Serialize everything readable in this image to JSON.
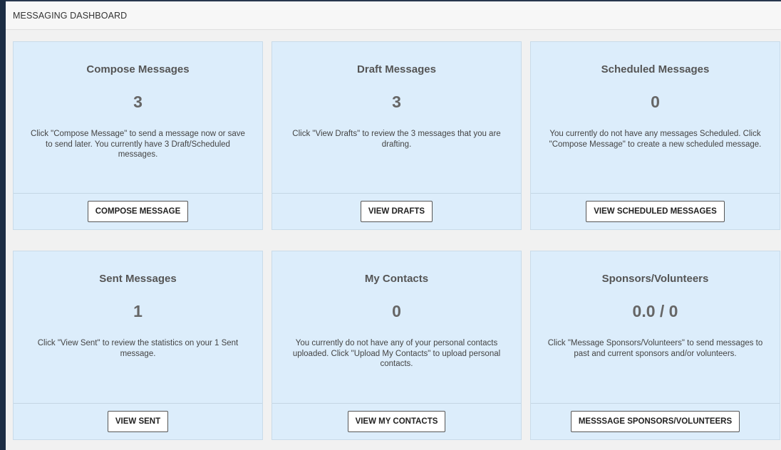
{
  "header": {
    "title": "MESSAGING DASHBOARD"
  },
  "cards": [
    {
      "title": "Compose Messages",
      "count": "3",
      "description": "Click \"Compose Message\" to send a message now or save to send later. You currently have 3 Draft/Scheduled messages.",
      "button": "COMPOSE MESSAGE"
    },
    {
      "title": "Draft Messages",
      "count": "3",
      "description": "Click \"View Drafts\" to review the 3 messages that you are drafting.",
      "button": "VIEW DRAFTS"
    },
    {
      "title": "Scheduled Messages",
      "count": "0",
      "description": "You currently do not have any messages Scheduled. Click \"Compose Message\" to create a new scheduled message.",
      "button": "VIEW SCHEDULED MESSAGES"
    },
    {
      "title": "Sent Messages",
      "count": "1",
      "description": "Click \"View Sent\" to review the statistics on your 1 Sent message.",
      "button": "VIEW SENT"
    },
    {
      "title": "My Contacts",
      "count": "0",
      "description": "You currently do not have any of your personal contacts uploaded. Click \"Upload My Contacts\" to upload personal contacts.",
      "button": "VIEW MY CONTACTS"
    },
    {
      "title": "Sponsors/Volunteers",
      "count": "0.0 / 0",
      "description": "Click \"Message Sponsors/Volunteers\" to send messages to past and current sponsors and/or volunteers.",
      "button": "MESSSAGE SPONSORS/VOLUNTEERS"
    }
  ],
  "colors": {
    "card_background": "#dcedfb",
    "page_background": "#f1f1f1",
    "outer_frame": "#1c2d44"
  }
}
